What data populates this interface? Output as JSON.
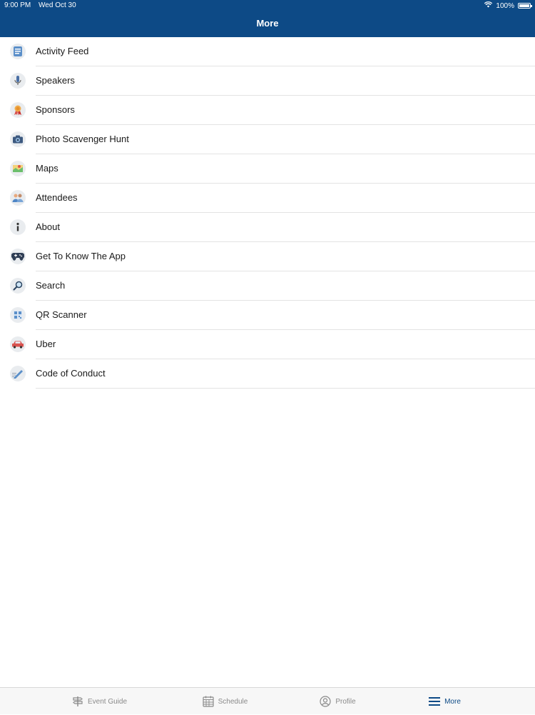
{
  "status": {
    "time": "9:00 PM",
    "date": "Wed Oct 30",
    "battery": "100%"
  },
  "nav": {
    "title": "More"
  },
  "menu": [
    {
      "label": "Activity Feed",
      "icon": "activity-feed-icon"
    },
    {
      "label": "Speakers",
      "icon": "microphone-icon"
    },
    {
      "label": "Sponsors",
      "icon": "ribbon-icon"
    },
    {
      "label": "Photo Scavenger Hunt",
      "icon": "camera-icon"
    },
    {
      "label": "Maps",
      "icon": "map-icon"
    },
    {
      "label": "Attendees",
      "icon": "people-icon"
    },
    {
      "label": "About",
      "icon": "info-icon"
    },
    {
      "label": "Get To Know The App",
      "icon": "gamepad-icon"
    },
    {
      "label": "Search",
      "icon": "magnifier-icon"
    },
    {
      "label": "QR Scanner",
      "icon": "qr-icon"
    },
    {
      "label": "Uber",
      "icon": "car-icon"
    },
    {
      "label": "Code of Conduct",
      "icon": "pen-icon"
    }
  ],
  "tabs": [
    {
      "label": "Event Guide",
      "icon": "signpost-icon"
    },
    {
      "label": "Schedule",
      "icon": "calendar-icon"
    },
    {
      "label": "Profile",
      "icon": "user-icon"
    },
    {
      "label": "More",
      "icon": "hamburger-icon"
    }
  ],
  "colors": {
    "brand": "#0d4a86",
    "tab_inactive": "#8a8a8a"
  }
}
